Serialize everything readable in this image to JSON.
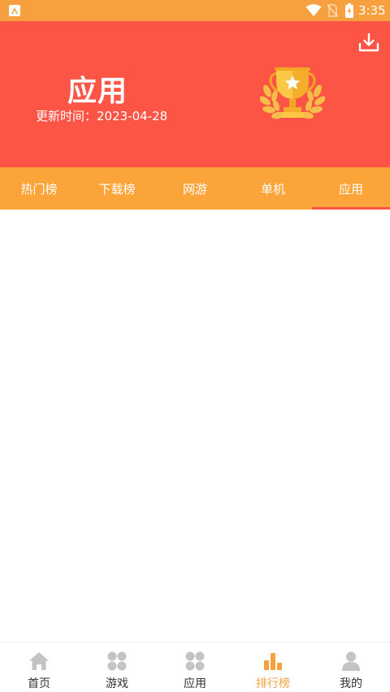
{
  "status_bar": {
    "time": "3:35",
    "icons": [
      "app-notification-icon",
      "wifi-icon",
      "no-sim-icon",
      "battery-charging-icon"
    ]
  },
  "header": {
    "title": "应用",
    "subtitle": "更新时间：2023-04-28",
    "background_color": "#fc5445",
    "icons": [
      "download-icon",
      "trophy-icon"
    ]
  },
  "tabs": {
    "items": [
      {
        "label": "热门榜",
        "active": false
      },
      {
        "label": "下载榜",
        "active": false
      },
      {
        "label": "网游",
        "active": false
      },
      {
        "label": "单机",
        "active": false
      },
      {
        "label": "应用",
        "active": true
      }
    ],
    "background_color": "#fba43a",
    "indicator_color": "#fc5445"
  },
  "bottom_nav": {
    "items": [
      {
        "label": "首页",
        "icon": "home-icon",
        "active": false
      },
      {
        "label": "游戏",
        "icon": "grid-icon",
        "active": false
      },
      {
        "label": "应用",
        "icon": "grid-icon",
        "active": false
      },
      {
        "label": "排行榜",
        "icon": "ranking-icon",
        "active": true
      },
      {
        "label": "我的",
        "icon": "user-icon",
        "active": false
      }
    ],
    "active_color": "#f7a03f",
    "inactive_icon_color": "#c4c4c4"
  }
}
